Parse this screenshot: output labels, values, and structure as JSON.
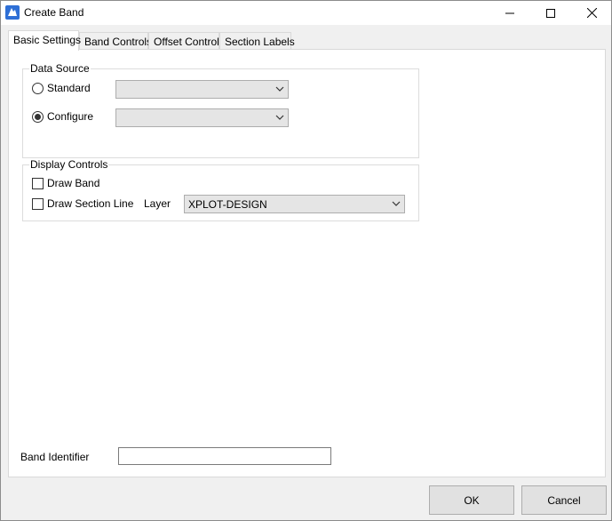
{
  "window": {
    "title": "Create Band",
    "icon": "app-logo-icon"
  },
  "tabs": [
    {
      "label": "Basic Settings",
      "active": true
    },
    {
      "label": "Band Controls",
      "active": false
    },
    {
      "label": "Offset Controls",
      "active": false
    },
    {
      "label": "Section Labels",
      "active": false
    }
  ],
  "data_source": {
    "legend": "Data Source",
    "standard_label": "Standard",
    "standard_checked": false,
    "standard_value": "",
    "configure_label": "Configure",
    "configure_checked": true,
    "configure_value": ""
  },
  "display_controls": {
    "legend": "Display Controls",
    "draw_band_label": "Draw Band",
    "draw_band_checked": false,
    "draw_section_line_label": "Draw Section Line",
    "draw_section_line_checked": false,
    "layer_label": "Layer",
    "layer_value": "XPLOT-DESIGN"
  },
  "band_identifier": {
    "label": "Band Identifier",
    "value": ""
  },
  "buttons": {
    "ok": "OK",
    "cancel": "Cancel"
  },
  "colors": {
    "title_bg": "#ffffff",
    "panel_bg": "#ffffff",
    "window_bg": "#f0f0f0",
    "combo_bg": "#e5e5e5",
    "app_icon": "#2e6fd6"
  }
}
